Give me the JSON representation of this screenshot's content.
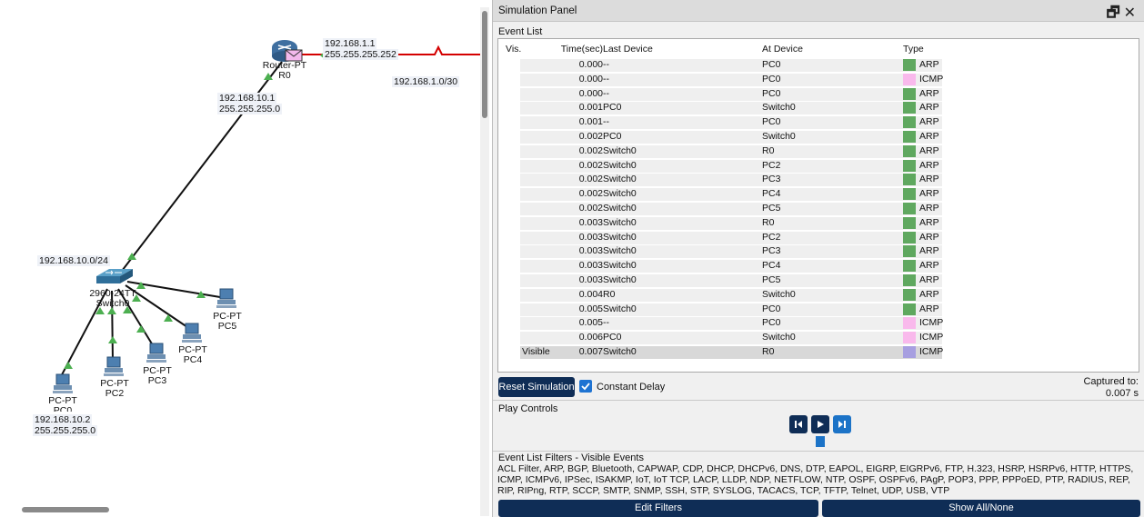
{
  "topology": {
    "router": {
      "name": "Router-PT",
      "label": "R0",
      "ip": "192.168.1.1",
      "mask": "255.255.255.252"
    },
    "wan_network": "192.168.1.0/30",
    "router_lan": {
      "ip": "192.168.10.1",
      "mask": "255.255.255.0"
    },
    "lan_network": "192.168.10.0/24",
    "switch": {
      "model": "2960-24TT",
      "label": "Switch0"
    },
    "pcs": [
      {
        "type": "PC-PT",
        "label": "PC0",
        "ip": "192.168.10.2",
        "mask": "255.255.255.0"
      },
      {
        "type": "PC-PT",
        "label": "PC2"
      },
      {
        "type": "PC-PT",
        "label": "PC3"
      },
      {
        "type": "PC-PT",
        "label": "PC4"
      },
      {
        "type": "PC-PT",
        "label": "PC5"
      }
    ]
  },
  "panel": {
    "title": "Simulation Panel",
    "event_list_label": "Event List",
    "columns": {
      "vis": "Vis.",
      "time": "Time(sec)",
      "last": "Last Device",
      "at": "At Device",
      "type": "Type"
    },
    "type_colors": {
      "ARP": "#5fa85f",
      "ICMP": "#f9b9ec",
      "ICMP_selected": "#a79fe0"
    },
    "events": [
      {
        "vis": "",
        "time": "0.000",
        "last": "--",
        "at": "PC0",
        "type": "ARP"
      },
      {
        "vis": "",
        "time": "0.000",
        "last": "--",
        "at": "PC0",
        "type": "ICMP"
      },
      {
        "vis": "",
        "time": "0.000",
        "last": "--",
        "at": "PC0",
        "type": "ARP"
      },
      {
        "vis": "",
        "time": "0.001",
        "last": "PC0",
        "at": "Switch0",
        "type": "ARP"
      },
      {
        "vis": "",
        "time": "0.001",
        "last": "--",
        "at": "PC0",
        "type": "ARP"
      },
      {
        "vis": "",
        "time": "0.002",
        "last": "PC0",
        "at": "Switch0",
        "type": "ARP"
      },
      {
        "vis": "",
        "time": "0.002",
        "last": "Switch0",
        "at": "R0",
        "type": "ARP"
      },
      {
        "vis": "",
        "time": "0.002",
        "last": "Switch0",
        "at": "PC2",
        "type": "ARP"
      },
      {
        "vis": "",
        "time": "0.002",
        "last": "Switch0",
        "at": "PC3",
        "type": "ARP"
      },
      {
        "vis": "",
        "time": "0.002",
        "last": "Switch0",
        "at": "PC4",
        "type": "ARP"
      },
      {
        "vis": "",
        "time": "0.002",
        "last": "Switch0",
        "at": "PC5",
        "type": "ARP"
      },
      {
        "vis": "",
        "time": "0.003",
        "last": "Switch0",
        "at": "R0",
        "type": "ARP"
      },
      {
        "vis": "",
        "time": "0.003",
        "last": "Switch0",
        "at": "PC2",
        "type": "ARP"
      },
      {
        "vis": "",
        "time": "0.003",
        "last": "Switch0",
        "at": "PC3",
        "type": "ARP"
      },
      {
        "vis": "",
        "time": "0.003",
        "last": "Switch0",
        "at": "PC4",
        "type": "ARP"
      },
      {
        "vis": "",
        "time": "0.003",
        "last": "Switch0",
        "at": "PC5",
        "type": "ARP"
      },
      {
        "vis": "",
        "time": "0.004",
        "last": "R0",
        "at": "Switch0",
        "type": "ARP"
      },
      {
        "vis": "",
        "time": "0.005",
        "last": "Switch0",
        "at": "PC0",
        "type": "ARP"
      },
      {
        "vis": "",
        "time": "0.005",
        "last": "--",
        "at": "PC0",
        "type": "ICMP"
      },
      {
        "vis": "",
        "time": "0.006",
        "last": "PC0",
        "at": "Switch0",
        "type": "ICMP"
      },
      {
        "vis": "Visible",
        "time": "0.007",
        "last": "Switch0",
        "at": "R0",
        "type": "ICMP",
        "selected": true
      }
    ],
    "reset_label": "Reset Simulation",
    "constant_delay_label": "Constant Delay",
    "captured_label": "Captured to:",
    "captured_value": "0.007 s",
    "play_controls_label": "Play Controls",
    "filters_label": "Event List Filters - Visible Events",
    "filters_list": "ACL Filter, ARP, BGP, Bluetooth, CAPWAP, CDP, DHCP, DHCPv6, DNS, DTP, EAPOL, EIGRP, EIGRPv6, FTP, H.323, HSRP, HSRPv6, HTTP, HTTPS, ICMP, ICMPv6, IPSec, ISAKMP, IoT, IoT TCP, LACP, LLDP, NDP, NETFLOW, NTP, OSPF, OSPFv6, PAgP, POP3, PPP, PPPoED, PTP, RADIUS, REP, RIP, RIPng, RTP, SCCP, SMTP, SNMP, SSH, STP, SYSLOG, TACACS, TCP, TFTP, Telnet, UDP, USB, VTP",
    "edit_filters_label": "Edit Filters",
    "show_all_label": "Show All/None"
  }
}
